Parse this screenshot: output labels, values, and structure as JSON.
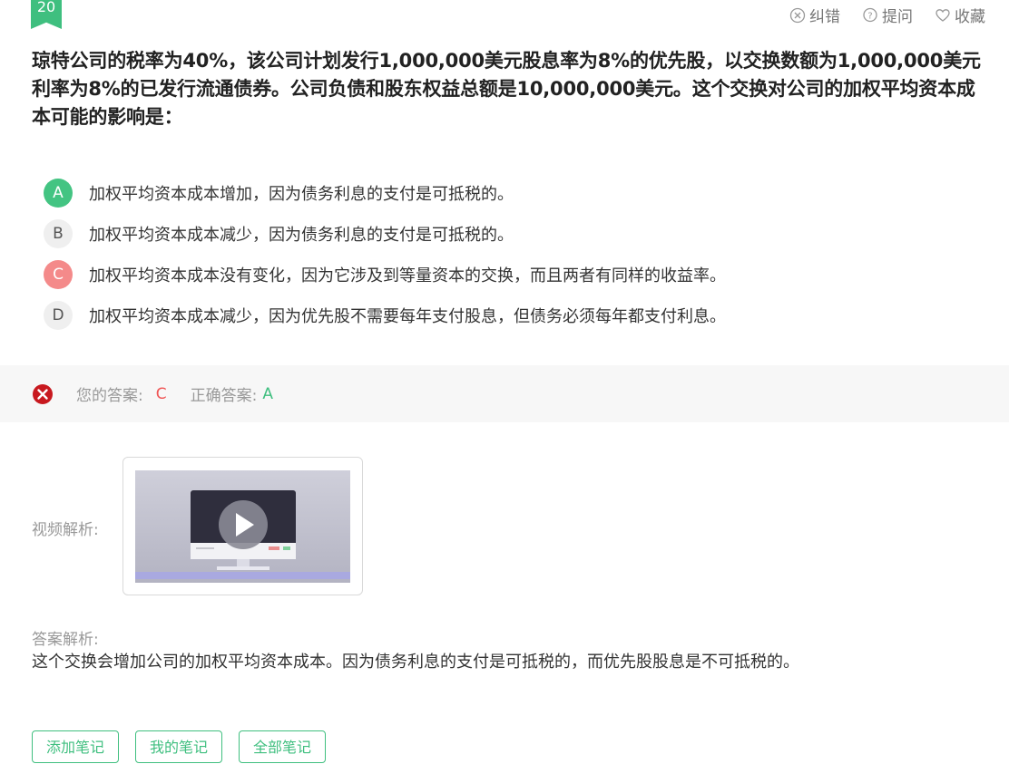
{
  "question_number": "20",
  "top_actions": [
    {
      "label": "纠错",
      "icon": "error-report-icon"
    },
    {
      "label": "提问",
      "icon": "question-icon"
    },
    {
      "label": "收藏",
      "icon": "heart-icon"
    }
  ],
  "question_text": "琼特公司的税率为40%，该公司计划发行1,000,000美元股息率为8%的优先股，以交换数额为1,000,000美元利率为8%的已发行流通债券。公司负债和股东权益总额是10,000,000美元。这个交换对公司的加权平均资本成本可能的影响是：",
  "options": [
    {
      "letter": "A",
      "text": "加权平均资本成本增加，因为债务利息的支付是可抵税的。",
      "state": "correct"
    },
    {
      "letter": "B",
      "text": "加权平均资本成本减少，因为债务利息的支付是可抵税的。",
      "state": "normal"
    },
    {
      "letter": "C",
      "text": "加权平均资本成本没有变化，因为它涉及到等量资本的交换，而且两者有同样的收益率。",
      "state": "wrong"
    },
    {
      "letter": "D",
      "text": "加权平均资本成本减少，因为优先股不需要每年支付股息，但债务必须每年都支付利息。",
      "state": "normal"
    }
  ],
  "answer_bar": {
    "your_answer_label": "您的答案:",
    "your_answer": "C",
    "correct_answer_label": "正确答案:",
    "correct_answer": "A"
  },
  "video_label": "视频解析:",
  "analysis_label": "答案解析:",
  "analysis_text": "这个交换会增加公司的加权平均资本成本。因为债务利息的支付是可抵税的，而优先股股息是不可抵税的。",
  "bottom_buttons": [
    "添加笔记",
    "我的笔记",
    "全部笔记"
  ],
  "colors": {
    "correct": "#43c482",
    "wrong": "#f48a8a",
    "accent": "#3fbf7f"
  }
}
